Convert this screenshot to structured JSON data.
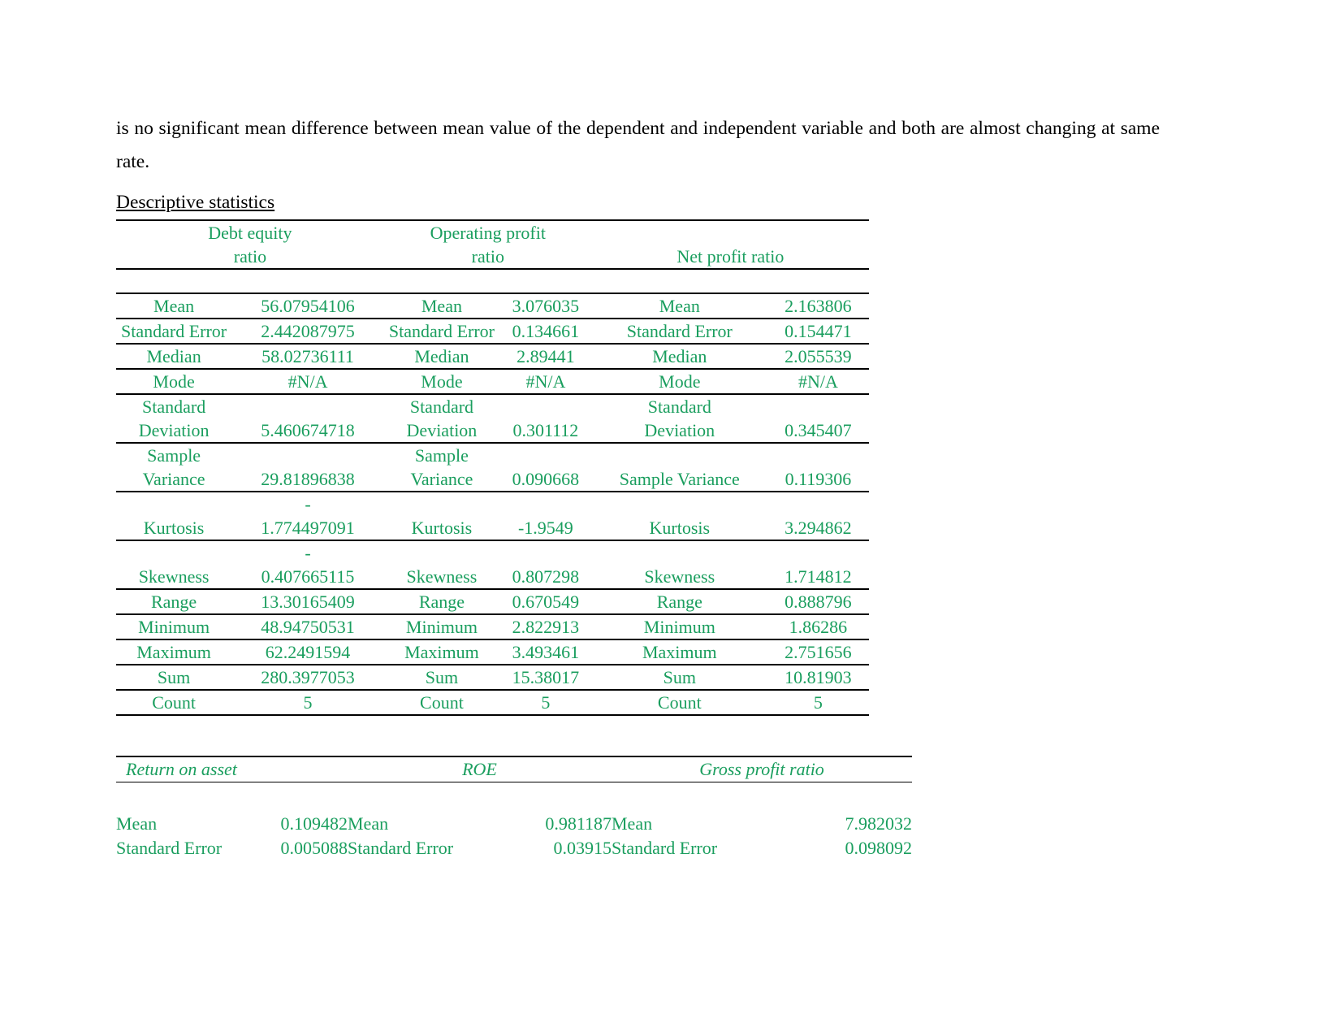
{
  "document": {
    "paragraph": "is no significant mean difference between mean value of the dependent and independent variable and both are almost changing at same rate.",
    "section_heading": "Descriptive statistics"
  },
  "stats_table": {
    "headers": [
      "Debt equity ratio",
      "Operating profit ratio",
      "Net profit  ratio"
    ],
    "header_lines": {
      "h1a": "Debt equity",
      "h1b": "ratio",
      "h2a": "Operating profit",
      "h2b": "ratio",
      "h3": "Net profit  ratio"
    },
    "rows": [
      {
        "l1": "Mean",
        "v1": "56.07954106",
        "l2": "Mean",
        "v2": "3.076035",
        "l3": "Mean",
        "v3": "2.163806"
      },
      {
        "l1": "Standard Error",
        "v1": "2.442087975",
        "l2": "Standard Error",
        "v2": "0.134661",
        "l3": "Standard Error",
        "v3": "0.154471"
      },
      {
        "l1": "Median",
        "v1": "58.02736111",
        "l2": "Median",
        "v2": "2.89441",
        "l3": "Median",
        "v3": "2.055539"
      },
      {
        "l1": "Mode",
        "v1": "#N/A",
        "l2": "Mode",
        "v2": "#N/A",
        "l3": "Mode",
        "v3": "#N/A"
      },
      {
        "l1a": "Standard",
        "l1b": "Deviation",
        "v1": "5.460674718",
        "l2a": "Standard",
        "l2b": "Deviation",
        "v2": "0.301112",
        "l3a": "Standard",
        "l3b": "Deviation",
        "v3": "0.345407"
      },
      {
        "l1a": "Sample",
        "l1b": "Variance",
        "v1": "29.81896838",
        "l2a": "Sample",
        "l2b": "Variance",
        "v2": "0.090668",
        "l3": "Sample Variance",
        "v3": "0.119306"
      },
      {
        "l1": "Kurtosis",
        "v1_sign": "-",
        "v1": "1.774497091",
        "l2": "Kurtosis",
        "v2": "-1.9549",
        "l3": "Kurtosis",
        "v3": "3.294862"
      },
      {
        "l1": "Skewness",
        "v1_sign": "-",
        "v1": "0.407665115",
        "l2": "Skewness",
        "v2": "0.807298",
        "l3": "Skewness",
        "v3": "1.714812"
      },
      {
        "l1": "Range",
        "v1": "13.30165409",
        "l2": "Range",
        "v2": "0.670549",
        "l3": "Range",
        "v3": "0.888796"
      },
      {
        "l1": "Minimum",
        "v1": "48.94750531",
        "l2": "Minimum",
        "v2": "2.822913",
        "l3": "Minimum",
        "v3": "1.86286"
      },
      {
        "l1": "Maximum",
        "v1": "62.2491594",
        "l2": "Maximum",
        "v2": "3.493461",
        "l3": "Maximum",
        "v3": "2.751656"
      },
      {
        "l1": "Sum",
        "v1": "280.3977053",
        "l2": "Sum",
        "v2": "15.38017",
        "l3": "Sum",
        "v3": "10.81903"
      },
      {
        "l1": "Count",
        "v1": "5",
        "l2": "Count",
        "v2": "5",
        "l3": "Count",
        "v3": "5"
      }
    ]
  },
  "ratio_table": {
    "headers": [
      "Return on asset",
      "ROE",
      "Gross profit ratio"
    ],
    "rows": [
      {
        "l1": "Mean",
        "v1": "0.109482",
        "l2": "Mean",
        "v2": "0.981187",
        "l3": "Mean",
        "v3": "7.982032"
      },
      {
        "l1": "Standard Error",
        "v1": "0.005088",
        "l2": "Standard Error",
        "v2": "0.03915",
        "l3": "Standard Error",
        "v3": "0.098092"
      }
    ]
  },
  "colors": {
    "table_text": "#1a9e5e",
    "body_text": "#000000",
    "rule": "#000000"
  }
}
